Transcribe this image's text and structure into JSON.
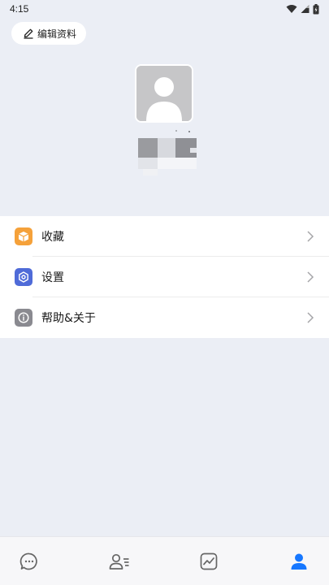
{
  "status_bar": {
    "time": "4:15",
    "icons": [
      "wifi-icon",
      "signal-icon",
      "battery-icon"
    ]
  },
  "header": {
    "edit_profile_label": "编辑资料",
    "edit_icon": "pencil-icon"
  },
  "menu": {
    "items": [
      {
        "label": "收藏",
        "icon": "box-icon",
        "color": "#f5a13a"
      },
      {
        "label": "设置",
        "icon": "gear-icon",
        "color": "#4f6bd8"
      },
      {
        "label": "帮助&关于",
        "icon": "info-icon",
        "color": "#8a8a90"
      }
    ]
  },
  "bottom_nav": {
    "tabs": [
      {
        "icon": "chat-icon",
        "active": false
      },
      {
        "icon": "contacts-icon",
        "active": false
      },
      {
        "icon": "activity-icon",
        "active": false
      },
      {
        "icon": "profile-icon",
        "active": true
      }
    ],
    "active_color": "#1677ff",
    "inactive_color": "#666666"
  }
}
